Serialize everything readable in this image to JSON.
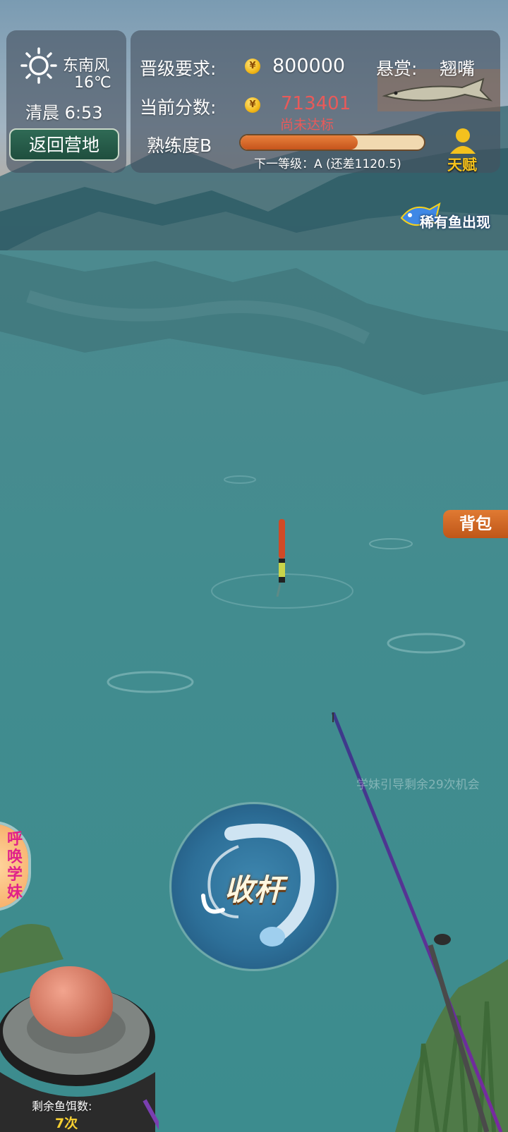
{
  "weather": {
    "icon": "sun-icon",
    "wind": "东南风",
    "temperature": "16℃",
    "time_label": "清晨 6:53"
  },
  "return_button": {
    "label": "返回营地"
  },
  "requirement": {
    "label": "晋级要求:",
    "value": "800000",
    "bounty_label": "悬赏:",
    "bounty_fish": "翘嘴"
  },
  "score": {
    "label": "当前分数:",
    "value": "713401",
    "status": "尚未达标"
  },
  "proficiency": {
    "label": "熟练度B",
    "progress_fraction": 0.64,
    "next_level": "下一等级：A (还差1120.5)"
  },
  "talent": {
    "label": "天赋"
  },
  "rare_fish": {
    "label": "稀有鱼出现"
  },
  "backpack": {
    "label": "背包"
  },
  "guide_notice": "学妹引导剩余29次机会",
  "reel_button": {
    "label": "收杆"
  },
  "summon": {
    "label": "呼唤学妹"
  },
  "bait": {
    "label": "剩余鱼饵数:",
    "count": "7次"
  },
  "colors": {
    "score_red": "#e85a5a",
    "progress_fill": "#d8692a",
    "return_green": "#2b5e4c",
    "backpack_orange": "#d0682a"
  }
}
